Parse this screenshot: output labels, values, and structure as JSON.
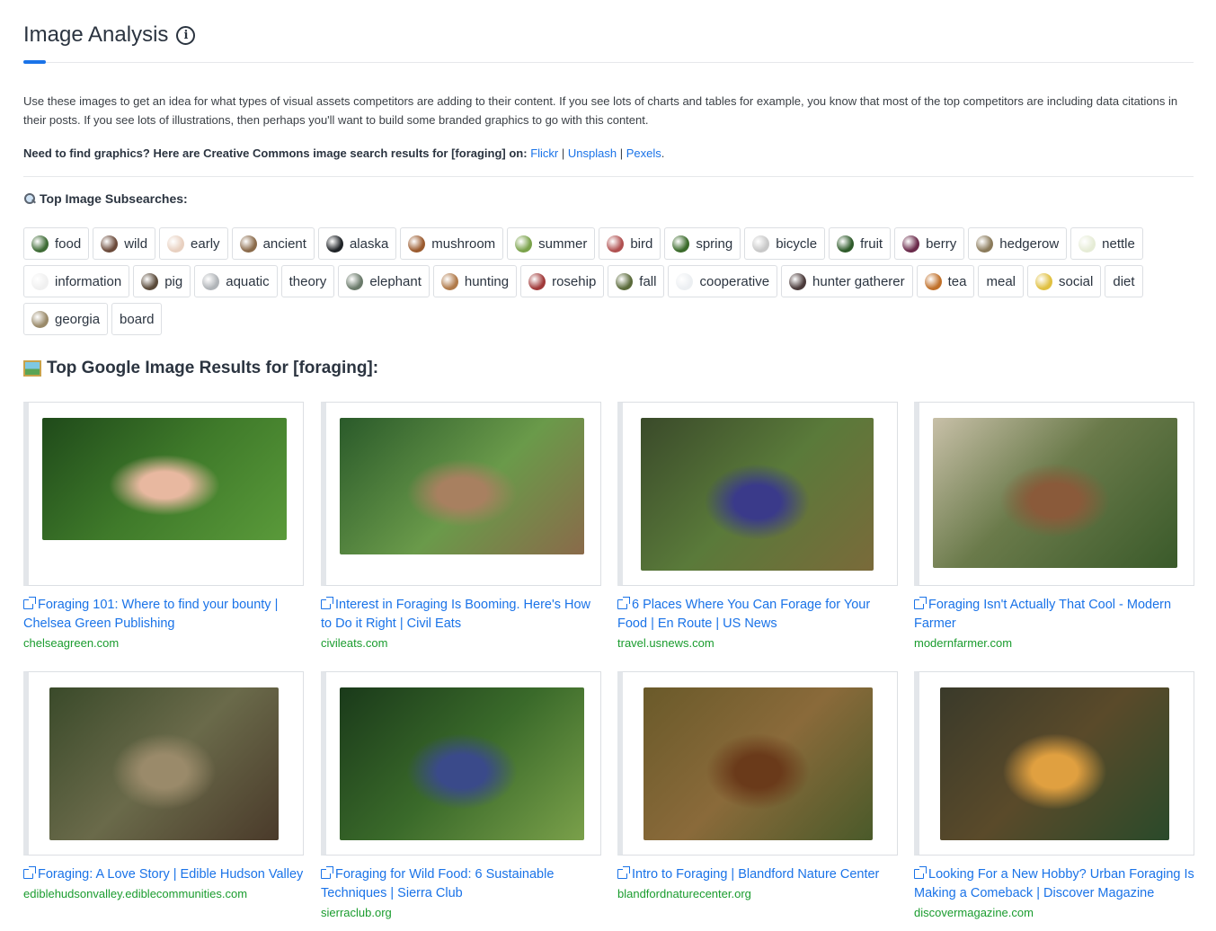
{
  "header": {
    "title": "Image Analysis"
  },
  "intro": {
    "text": "Use these images to get an idea for what types of visual assets competitors are adding to their content. If you see lots of charts and tables for example, you know that most of the top competitors are including data citations in their posts. If you see lots of illustrations, then perhaps you'll want to build some branded graphics to go with this content.",
    "need_text": "Need to find graphics? Here are Creative Commons image search results for [foraging] on:",
    "links": [
      "Flickr",
      "Unsplash",
      "Pexels"
    ],
    "separator": "|",
    "end": "."
  },
  "subsearches": {
    "title": "Top Image Subsearches:",
    "items": [
      {
        "label": "food",
        "thumb": true,
        "color": "#3e6b35"
      },
      {
        "label": "wild",
        "thumb": true,
        "color": "#6b4a3a"
      },
      {
        "label": "early",
        "thumb": true,
        "color": "#e8d0c0"
      },
      {
        "label": "ancient",
        "thumb": true,
        "color": "#8a6a4a"
      },
      {
        "label": "alaska",
        "thumb": true,
        "color": "#1e2226"
      },
      {
        "label": "mushroom",
        "thumb": true,
        "color": "#9a5a2e"
      },
      {
        "label": "summer",
        "thumb": true,
        "color": "#7aa24a"
      },
      {
        "label": "bird",
        "thumb": true,
        "color": "#b05050"
      },
      {
        "label": "spring",
        "thumb": true,
        "color": "#3a6a2a"
      },
      {
        "label": "bicycle",
        "thumb": true,
        "color": "#c8c8c8"
      },
      {
        "label": "fruit",
        "thumb": true,
        "color": "#2e5a2a"
      },
      {
        "label": "berry",
        "thumb": true,
        "color": "#6a2a4a"
      },
      {
        "label": "hedgerow",
        "thumb": true,
        "color": "#8a7a5a"
      },
      {
        "label": "nettle",
        "thumb": true,
        "color": "#e6ecd6"
      },
      {
        "label": "information",
        "thumb": true,
        "color": "#f0f0f0"
      },
      {
        "label": "pig",
        "thumb": true,
        "color": "#5a4a3a"
      },
      {
        "label": "aquatic",
        "thumb": true,
        "color": "#b0b4b8"
      },
      {
        "label": "theory",
        "thumb": false,
        "color": ""
      },
      {
        "label": "elephant",
        "thumb": true,
        "color": "#6a7a6a"
      },
      {
        "label": "hunting",
        "thumb": true,
        "color": "#b07a4a"
      },
      {
        "label": "rosehip",
        "thumb": true,
        "color": "#a03a3a"
      },
      {
        "label": "fall",
        "thumb": true,
        "color": "#5a6a3a"
      },
      {
        "label": "cooperative",
        "thumb": true,
        "color": "#eceff2"
      },
      {
        "label": "hunter gatherer",
        "thumb": true,
        "color": "#4a3a3a"
      },
      {
        "label": "tea",
        "thumb": true,
        "color": "#c0702a"
      },
      {
        "label": "meal",
        "thumb": false,
        "color": ""
      },
      {
        "label": "social",
        "thumb": true,
        "color": "#e0c040"
      },
      {
        "label": "diet",
        "thumb": false,
        "color": ""
      },
      {
        "label": "georgia",
        "thumb": true,
        "color": "#9a8a6a"
      },
      {
        "label": "board",
        "thumb": false,
        "color": ""
      }
    ]
  },
  "results": {
    "title": "Top Google Image Results for [foraging]:",
    "items": [
      {
        "title": "Foraging 101: Where to find your bounty | Chelsea Green Publishing",
        "domain": "chelseagreen.com",
        "bg": "linear-gradient(135deg,#1f4a1a,#3f7a2a 50%,#5a9a3a)",
        "accent": "#e8b8a0"
      },
      {
        "title": "Interest in Foraging Is Booming. Here's How to Do it Right | Civil Eats",
        "domain": "civileats.com",
        "bg": "linear-gradient(135deg,#2a5a2a,#6a9a4a 55%,#8a6a4a)",
        "accent": "#a88060"
      },
      {
        "title": "6 Places Where You Can Forage for Your Food | En Route | US News",
        "domain": "travel.usnews.com",
        "bg": "linear-gradient(135deg,#3a4a2a,#5a7a3a 50%,#7a6a3a)",
        "accent": "#3a3a8a"
      },
      {
        "title": "Foraging Isn't Actually That Cool - Modern Farmer",
        "domain": "modernfarmer.com",
        "bg": "linear-gradient(135deg,#c8c0a8,#6a7a4a 45%,#3a5a2a)",
        "accent": "#8a5a3a"
      },
      {
        "title": "Foraging: A Love Story | Edible Hudson Valley",
        "domain": "ediblehudsonvalley.ediblecommunities.com",
        "bg": "linear-gradient(135deg,#3a4a2a,#6a6a4a 50%,#4a3a2a)",
        "accent": "#9a8a6a"
      },
      {
        "title": "Foraging for Wild Food: 6 Sustainable Techniques | Sierra Club",
        "domain": "sierraclub.org",
        "bg": "linear-gradient(135deg,#1a3a1a,#3a6a2a 50%,#7aa04a)",
        "accent": "#3a4a8a"
      },
      {
        "title": "Intro to Foraging | Blandford Nature Center",
        "domain": "blandfordnaturecenter.org",
        "bg": "linear-gradient(135deg,#6a5a2a,#8a6a3a 50%,#4a5a2a)",
        "accent": "#6a3a1a"
      },
      {
        "title": "Looking For a New Hobby? Urban Foraging Is Making a Comeback | Discover Magazine",
        "domain": "discovermagazine.com",
        "bg": "linear-gradient(135deg,#3a3a2a,#5a4a2a 50%,#2a4a2a)",
        "accent": "#e0a040"
      }
    ]
  }
}
